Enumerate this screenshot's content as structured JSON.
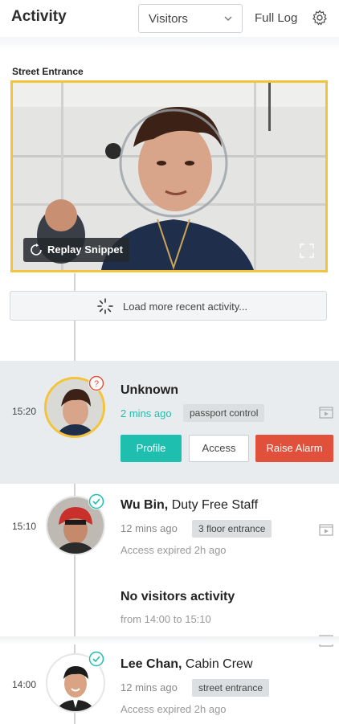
{
  "header": {
    "title": "Activity",
    "filter_selected": "Visitors",
    "full_log_label": "Full Log"
  },
  "camera": {
    "label": "Street Entrance",
    "replay_label": "Replay Snippet"
  },
  "load_more": {
    "label": "Load more recent activity..."
  },
  "events": [
    {
      "time": "15:20",
      "name": "Unknown",
      "role": "",
      "ago": "2 mins ago",
      "location": "passport control",
      "status": "unknown",
      "actions": {
        "profile": "Profile",
        "access": "Access",
        "alarm": "Raise Alarm"
      }
    },
    {
      "time": "15:10",
      "name": "Wu Bin,",
      "role": "Duty Free Staff",
      "ago": "12 mins ago",
      "location": "3 floor entrance",
      "note": "Access expired 2h ago",
      "status": "verified"
    },
    {
      "time": "14:00",
      "name": "Lee Chan,",
      "role": "Cabin Crew",
      "ago": "12 mins ago",
      "location": "street entrance",
      "note": "Access expired 2h ago",
      "status": "verified"
    }
  ],
  "gap": {
    "title": "No visitors activity",
    "range": "from 14:00 to 15:10"
  },
  "colors": {
    "accent_teal": "#1fbfb0",
    "alarm_red": "#e0503a",
    "highlight_yellow": "#f3c33a"
  },
  "icons": [
    "chevron-down-icon",
    "gear-icon",
    "replay-icon",
    "expand-icon",
    "spinner-icon",
    "video-icon",
    "question-badge-icon",
    "check-badge-icon"
  ]
}
